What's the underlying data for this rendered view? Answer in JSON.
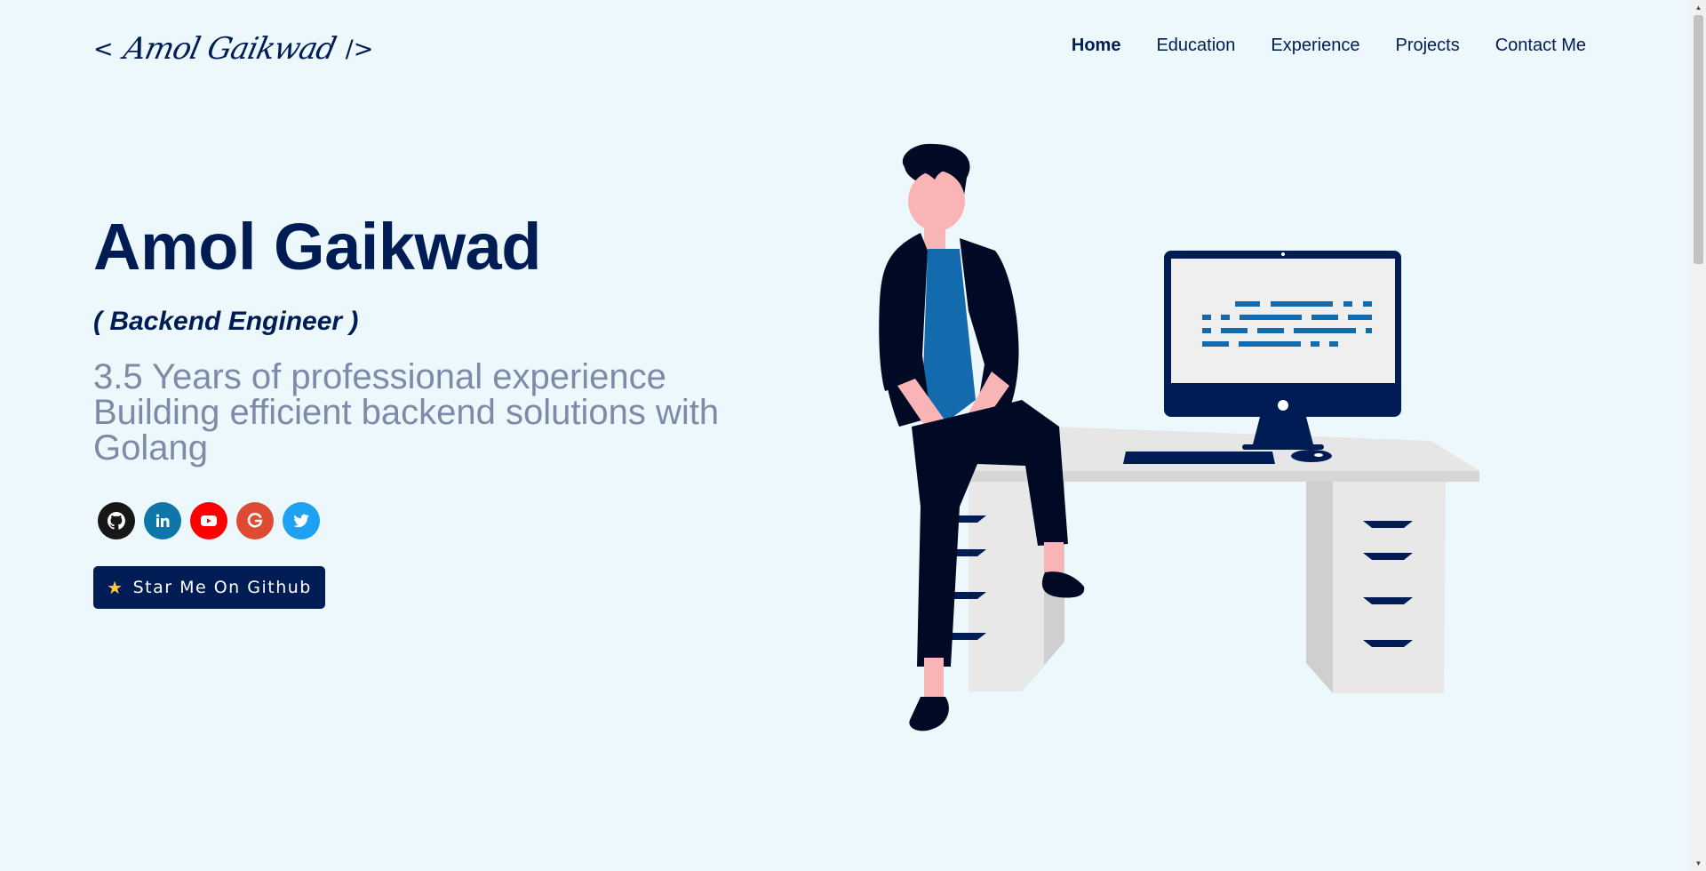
{
  "header": {
    "logo": {
      "open": "<",
      "signature": "Amol Gaikwad",
      "close": "/>"
    },
    "nav": [
      {
        "label": "Home",
        "active": true
      },
      {
        "label": "Education",
        "active": false
      },
      {
        "label": "Experience",
        "active": false
      },
      {
        "label": "Projects",
        "active": false
      },
      {
        "label": "Contact Me",
        "active": false
      }
    ]
  },
  "hero": {
    "name": "Amol Gaikwad",
    "role": "( Backend Engineer )",
    "tagline": [
      "3.5 Years of professional experience",
      "Building efficient backend solutions with",
      "Golang"
    ],
    "socials": [
      {
        "name": "github-icon",
        "color": "#181717"
      },
      {
        "name": "linkedin-icon",
        "color": "#0e76a8"
      },
      {
        "name": "youtube-icon",
        "color": "#ff0000"
      },
      {
        "name": "google-icon",
        "color": "#df4a32"
      },
      {
        "name": "twitter-icon",
        "color": "#1da1f2"
      }
    ],
    "button": {
      "icon": "star-icon",
      "label": "Star Me On Github"
    }
  },
  "colors": {
    "background": "#edf8fd",
    "primary": "#001c55",
    "muted": "#7b8ba8"
  }
}
